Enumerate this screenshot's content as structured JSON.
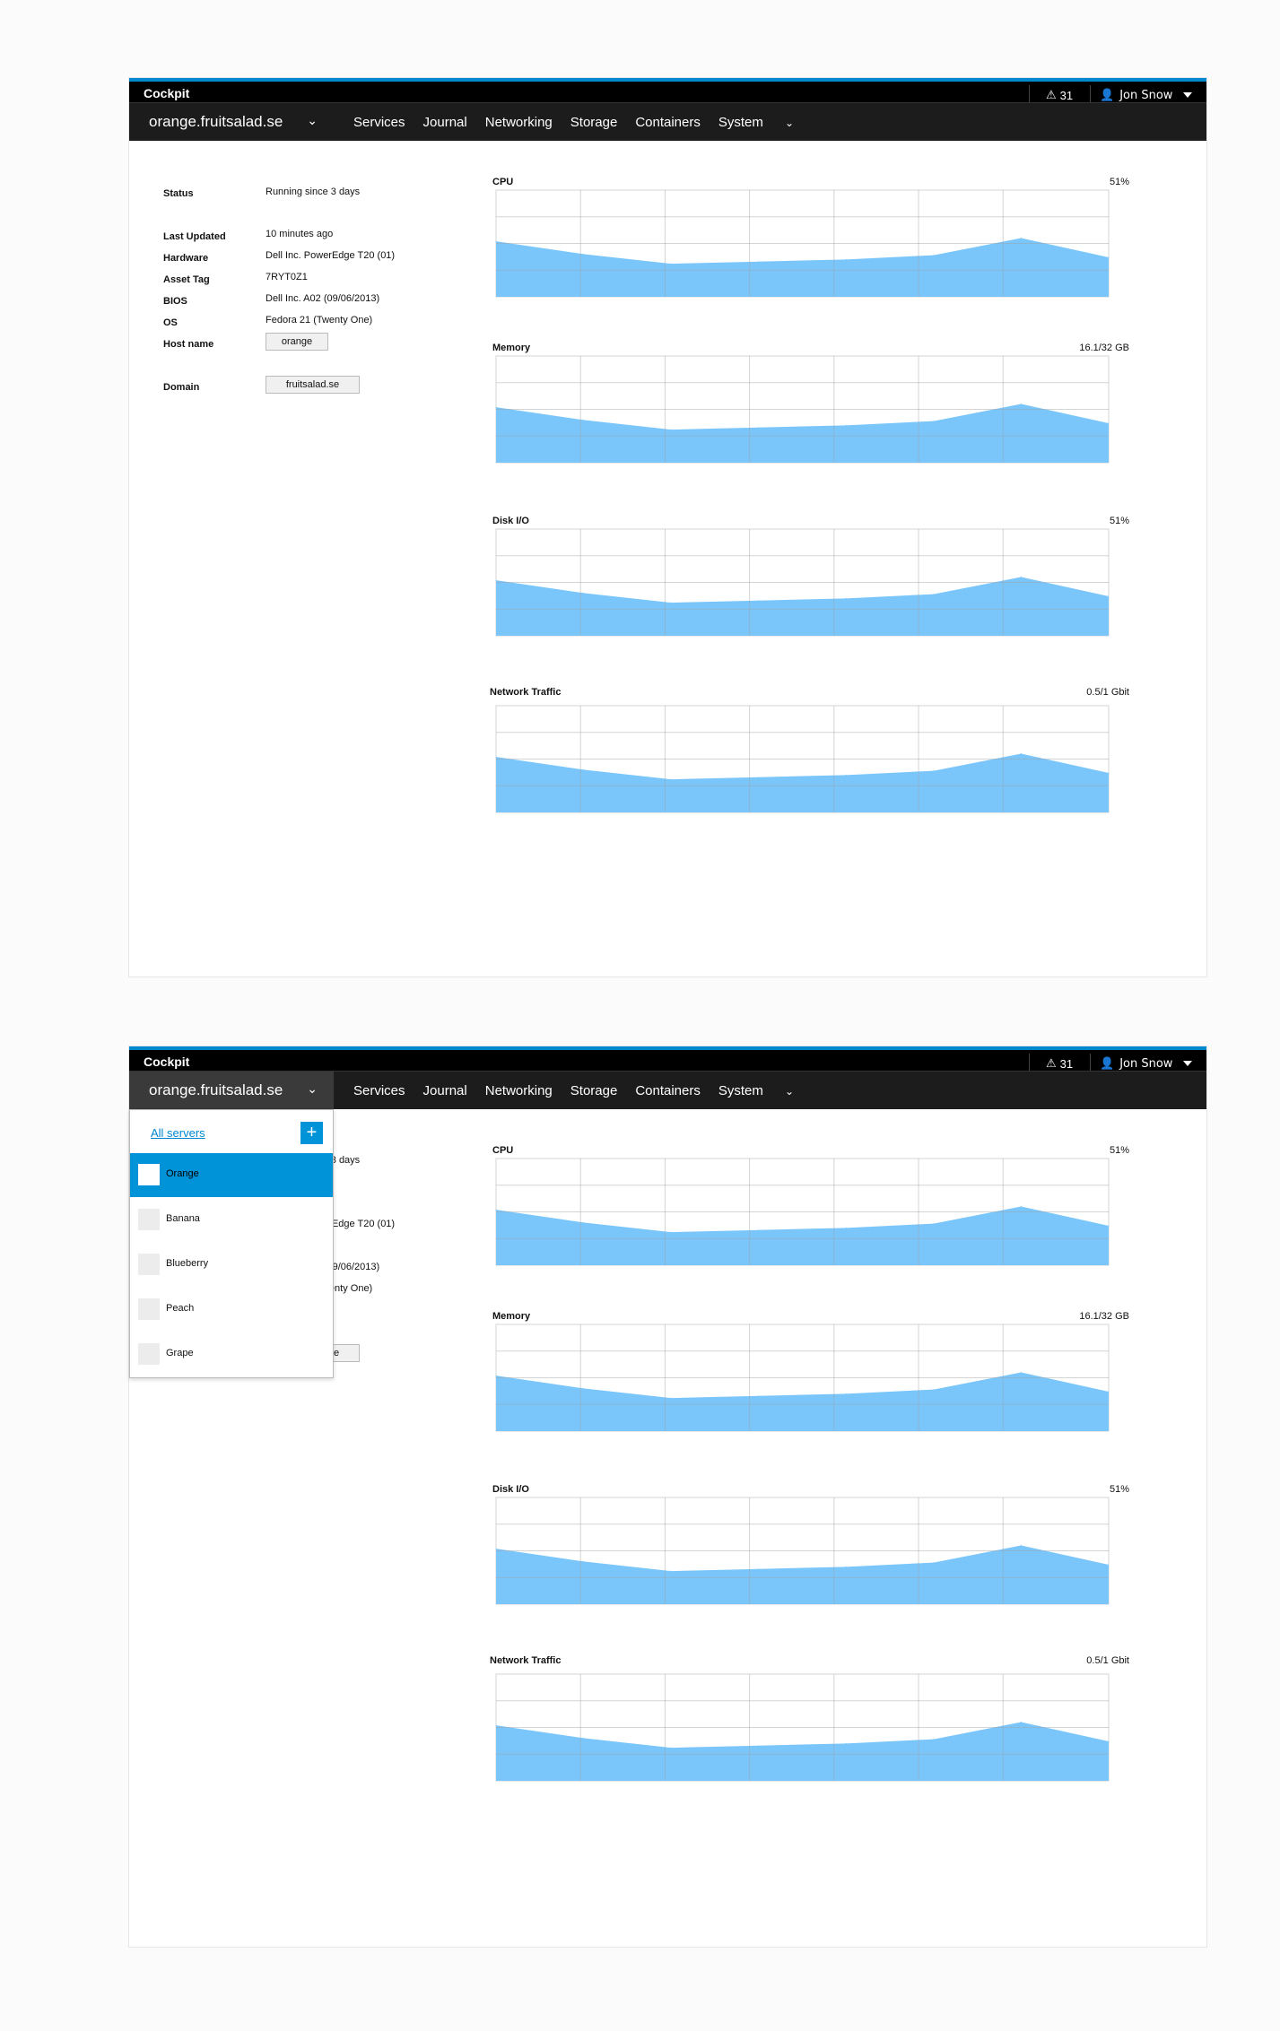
{
  "app": {
    "brand": "Cockpit",
    "alert_count": "31",
    "user_name": "Jon Snow"
  },
  "nav": {
    "host": "orange.fruitsalad.se",
    "items": [
      "Services",
      "Journal",
      "Networking",
      "Storage",
      "Containers",
      "System"
    ]
  },
  "info": {
    "status_label": "Status",
    "status_value": "Running since 3 days",
    "last_updated_label": "Last Updated",
    "last_updated_value": "10 minutes ago",
    "hardware_label": "Hardware",
    "hardware_value": "Dell Inc. PowerEdge T20 (01)",
    "asset_tag_label": "Asset Tag",
    "asset_tag_value": "7RYT0Z1",
    "bios_label": "BIOS",
    "bios_value": "Dell Inc. A02 (09/06/2013)",
    "os_label": "OS",
    "os_value": "Fedora 21 (Twenty One)",
    "hostname_label": "Host name",
    "hostname_value": "orange",
    "domain_label": "Domain",
    "domain_value": "fruitsalad.se"
  },
  "charts": [
    {
      "title": "CPU",
      "value": "51%"
    },
    {
      "title": "Memory",
      "value": "16.1/32 GB"
    },
    {
      "title": "Disk I/O",
      "value": "51%"
    },
    {
      "title": "Network Traffic",
      "value": "0.5/1 Gbit"
    }
  ],
  "chart_data": {
    "type": "area",
    "x": [
      0,
      1,
      2,
      3,
      4,
      5,
      6,
      7
    ],
    "values": [
      0.52,
      0.4,
      0.31,
      0.33,
      0.35,
      0.39,
      0.55,
      0.37
    ],
    "ylim": [
      0,
      1
    ],
    "grid": true,
    "color": "#7ac6fb"
  },
  "server_menu": {
    "all_servers": "All servers",
    "add_label": "+",
    "items": [
      "Orange",
      "Banana",
      "Blueberry",
      "Peach",
      "Grape"
    ],
    "selected": "Orange"
  },
  "colors": {
    "accent": "#0087cf",
    "selected": "#0093d8",
    "area_fill": "#7ac6fb",
    "navbar": "#1c1c1c"
  }
}
